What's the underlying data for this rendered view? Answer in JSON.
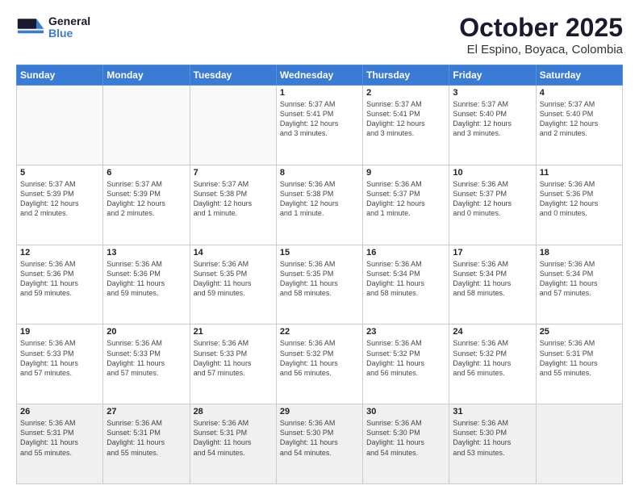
{
  "header": {
    "logo": {
      "general": "General",
      "blue": "Blue"
    },
    "month_title": "October 2025",
    "location": "El Espino, Boyaca, Colombia"
  },
  "weekdays": [
    "Sunday",
    "Monday",
    "Tuesday",
    "Wednesday",
    "Thursday",
    "Friday",
    "Saturday"
  ],
  "weeks": [
    [
      {
        "num": "",
        "info": ""
      },
      {
        "num": "",
        "info": ""
      },
      {
        "num": "",
        "info": ""
      },
      {
        "num": "1",
        "info": "Sunrise: 5:37 AM\nSunset: 5:41 PM\nDaylight: 12 hours\nand 3 minutes."
      },
      {
        "num": "2",
        "info": "Sunrise: 5:37 AM\nSunset: 5:41 PM\nDaylight: 12 hours\nand 3 minutes."
      },
      {
        "num": "3",
        "info": "Sunrise: 5:37 AM\nSunset: 5:40 PM\nDaylight: 12 hours\nand 3 minutes."
      },
      {
        "num": "4",
        "info": "Sunrise: 5:37 AM\nSunset: 5:40 PM\nDaylight: 12 hours\nand 2 minutes."
      }
    ],
    [
      {
        "num": "5",
        "info": "Sunrise: 5:37 AM\nSunset: 5:39 PM\nDaylight: 12 hours\nand 2 minutes."
      },
      {
        "num": "6",
        "info": "Sunrise: 5:37 AM\nSunset: 5:39 PM\nDaylight: 12 hours\nand 2 minutes."
      },
      {
        "num": "7",
        "info": "Sunrise: 5:37 AM\nSunset: 5:38 PM\nDaylight: 12 hours\nand 1 minute."
      },
      {
        "num": "8",
        "info": "Sunrise: 5:36 AM\nSunset: 5:38 PM\nDaylight: 12 hours\nand 1 minute."
      },
      {
        "num": "9",
        "info": "Sunrise: 5:36 AM\nSunset: 5:37 PM\nDaylight: 12 hours\nand 1 minute."
      },
      {
        "num": "10",
        "info": "Sunrise: 5:36 AM\nSunset: 5:37 PM\nDaylight: 12 hours\nand 0 minutes."
      },
      {
        "num": "11",
        "info": "Sunrise: 5:36 AM\nSunset: 5:36 PM\nDaylight: 12 hours\nand 0 minutes."
      }
    ],
    [
      {
        "num": "12",
        "info": "Sunrise: 5:36 AM\nSunset: 5:36 PM\nDaylight: 11 hours\nand 59 minutes."
      },
      {
        "num": "13",
        "info": "Sunrise: 5:36 AM\nSunset: 5:36 PM\nDaylight: 11 hours\nand 59 minutes."
      },
      {
        "num": "14",
        "info": "Sunrise: 5:36 AM\nSunset: 5:35 PM\nDaylight: 11 hours\nand 59 minutes."
      },
      {
        "num": "15",
        "info": "Sunrise: 5:36 AM\nSunset: 5:35 PM\nDaylight: 11 hours\nand 58 minutes."
      },
      {
        "num": "16",
        "info": "Sunrise: 5:36 AM\nSunset: 5:34 PM\nDaylight: 11 hours\nand 58 minutes."
      },
      {
        "num": "17",
        "info": "Sunrise: 5:36 AM\nSunset: 5:34 PM\nDaylight: 11 hours\nand 58 minutes."
      },
      {
        "num": "18",
        "info": "Sunrise: 5:36 AM\nSunset: 5:34 PM\nDaylight: 11 hours\nand 57 minutes."
      }
    ],
    [
      {
        "num": "19",
        "info": "Sunrise: 5:36 AM\nSunset: 5:33 PM\nDaylight: 11 hours\nand 57 minutes."
      },
      {
        "num": "20",
        "info": "Sunrise: 5:36 AM\nSunset: 5:33 PM\nDaylight: 11 hours\nand 57 minutes."
      },
      {
        "num": "21",
        "info": "Sunrise: 5:36 AM\nSunset: 5:33 PM\nDaylight: 11 hours\nand 57 minutes."
      },
      {
        "num": "22",
        "info": "Sunrise: 5:36 AM\nSunset: 5:32 PM\nDaylight: 11 hours\nand 56 minutes."
      },
      {
        "num": "23",
        "info": "Sunrise: 5:36 AM\nSunset: 5:32 PM\nDaylight: 11 hours\nand 56 minutes."
      },
      {
        "num": "24",
        "info": "Sunrise: 5:36 AM\nSunset: 5:32 PM\nDaylight: 11 hours\nand 56 minutes."
      },
      {
        "num": "25",
        "info": "Sunrise: 5:36 AM\nSunset: 5:31 PM\nDaylight: 11 hours\nand 55 minutes."
      }
    ],
    [
      {
        "num": "26",
        "info": "Sunrise: 5:36 AM\nSunset: 5:31 PM\nDaylight: 11 hours\nand 55 minutes."
      },
      {
        "num": "27",
        "info": "Sunrise: 5:36 AM\nSunset: 5:31 PM\nDaylight: 11 hours\nand 55 minutes."
      },
      {
        "num": "28",
        "info": "Sunrise: 5:36 AM\nSunset: 5:31 PM\nDaylight: 11 hours\nand 54 minutes."
      },
      {
        "num": "29",
        "info": "Sunrise: 5:36 AM\nSunset: 5:30 PM\nDaylight: 11 hours\nand 54 minutes."
      },
      {
        "num": "30",
        "info": "Sunrise: 5:36 AM\nSunset: 5:30 PM\nDaylight: 11 hours\nand 54 minutes."
      },
      {
        "num": "31",
        "info": "Sunrise: 5:36 AM\nSunset: 5:30 PM\nDaylight: 11 hours\nand 53 minutes."
      },
      {
        "num": "",
        "info": ""
      }
    ]
  ]
}
